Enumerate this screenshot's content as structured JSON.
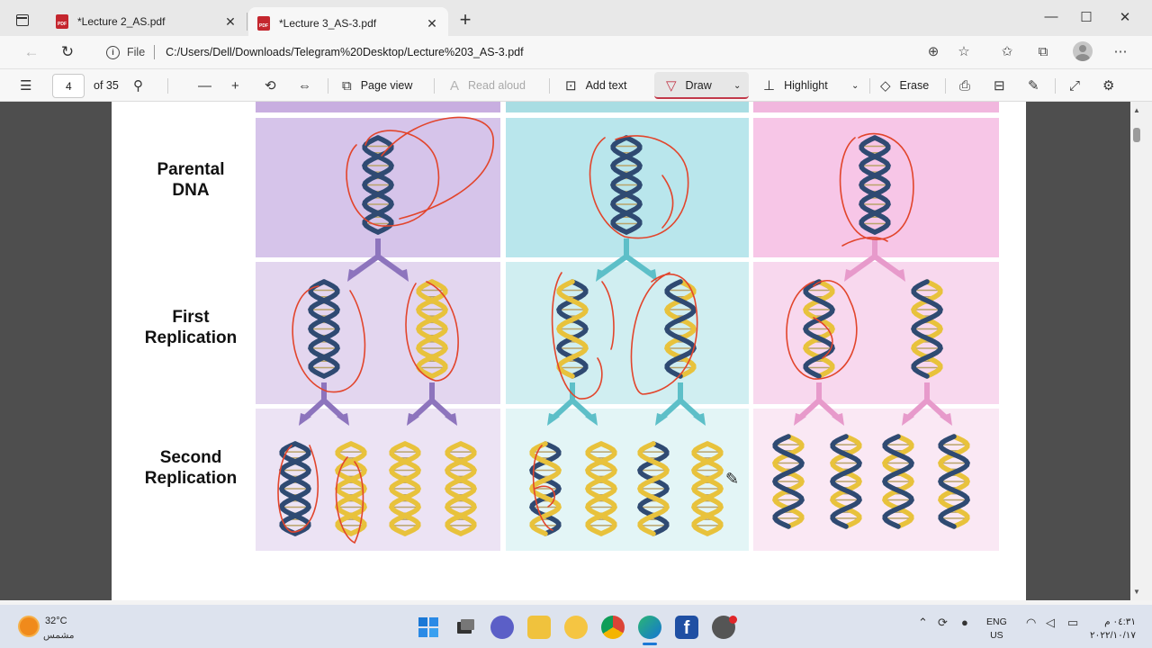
{
  "browser": {
    "tabs": [
      {
        "title": "*Lecture 2_AS.pdf",
        "active": false
      },
      {
        "title": "*Lecture 3_AS-3.pdf",
        "active": true
      }
    ],
    "address": {
      "scheme_label": "File",
      "url": "C:/Users/Dell/Downloads/Telegram%20Desktop/Lecture%203_AS-3.pdf"
    }
  },
  "pdf_toolbar": {
    "page_current": "4",
    "page_total": "of 35",
    "page_view": "Page view",
    "read_aloud": "Read aloud",
    "add_text": "Add text",
    "draw": "Draw",
    "highlight": "Highlight",
    "erase": "Erase"
  },
  "figure": {
    "row_labels": [
      {
        "line1": "Parental",
        "line2": "DNA"
      },
      {
        "line1": "First",
        "line2": "Replication"
      },
      {
        "line1": "Second",
        "line2": "Replication"
      }
    ],
    "columns": [
      {
        "scheme": "conservative",
        "header_color": "#c8aee0",
        "cell_colors": [
          "#d6c4ea",
          "#e3d6ef",
          "#ece3f4"
        ],
        "arrow_color": "#8d74bd"
      },
      {
        "scheme": "semiconservative",
        "header_color": "#a9dde3",
        "cell_colors": [
          "#b9e6ec",
          "#d0eef1",
          "#e3f5f6"
        ],
        "arrow_color": "#5dbfc8"
      },
      {
        "scheme": "dispersive",
        "header_color": "#f1b7de",
        "cell_colors": [
          "#f7c6e7",
          "#f8d8ee",
          "#fae8f4"
        ],
        "arrow_color": "#e79acb"
      }
    ],
    "colors": {
      "parent_strand": "#2f4a72",
      "new_strand": "#e8c23c",
      "annotation": "#e2452c"
    }
  },
  "taskbar": {
    "weather_temp": "32°C",
    "weather_desc": "مشمس",
    "lang_line1": "ENG",
    "lang_line2": "US",
    "time": "٠٤:٣١ م",
    "date": "٢٠٢٢/١٠/١٧"
  }
}
